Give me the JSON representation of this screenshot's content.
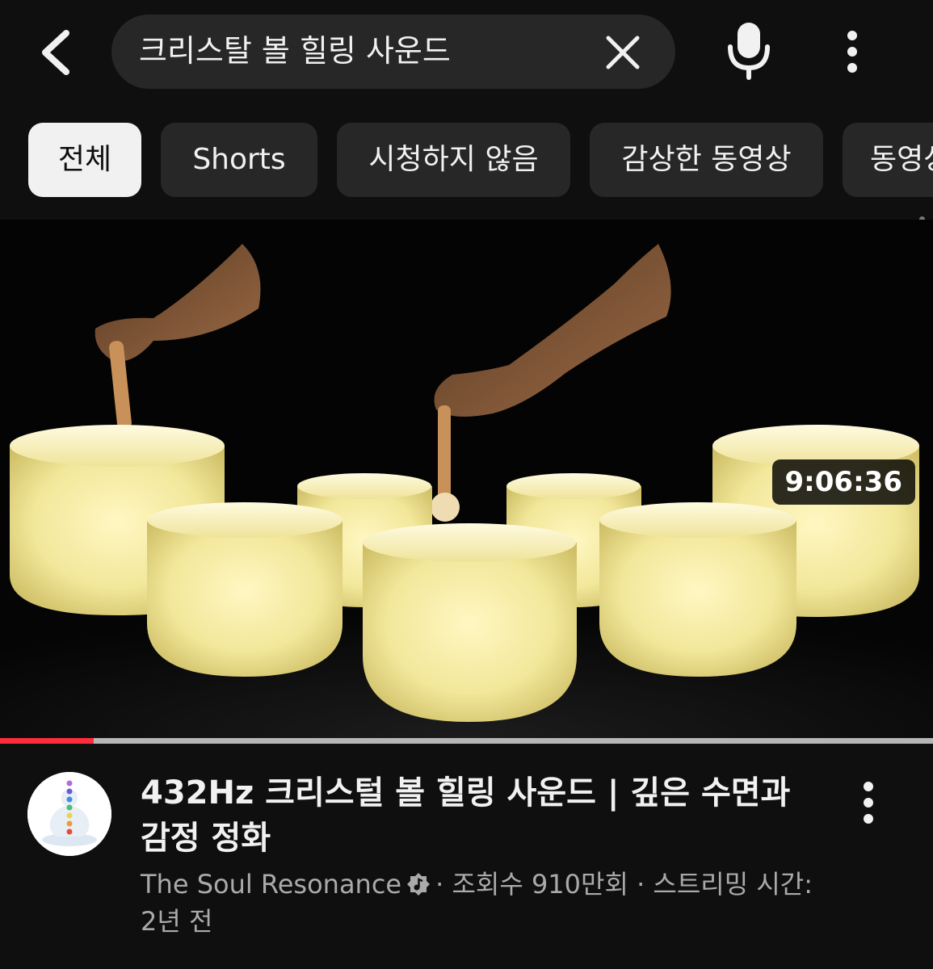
{
  "search": {
    "query": "크리스탈 볼 힐링 사운드"
  },
  "icons": {
    "back": "chevron-left-icon",
    "clear": "close-icon",
    "mic": "microphone-icon",
    "more": "more-vertical-icon",
    "verified": "verified-music-icon"
  },
  "filters": [
    {
      "label": "전체",
      "active": true
    },
    {
      "label": "Shorts",
      "active": false
    },
    {
      "label": "시청하지 않음",
      "active": false
    },
    {
      "label": "감상한 동영상",
      "active": false
    },
    {
      "label": "동영상",
      "active": false
    }
  ],
  "video": {
    "duration": "9:06:36",
    "watched_fraction": 0.1,
    "title": "432Hz 크리스털 볼 힐링 사운드 | 깊은 수면과 감정 정화",
    "channel": "The Soul Resonance",
    "views": "· 조회수 910만회 · 스트리밍 시간:",
    "age": "2년 전"
  },
  "colors": {
    "background": "#0f0f0f",
    "chip": "#272727",
    "chip_active": "#f1f1f1",
    "progress": "#ff2c3b",
    "secondary_text": "#aaaaaa"
  }
}
